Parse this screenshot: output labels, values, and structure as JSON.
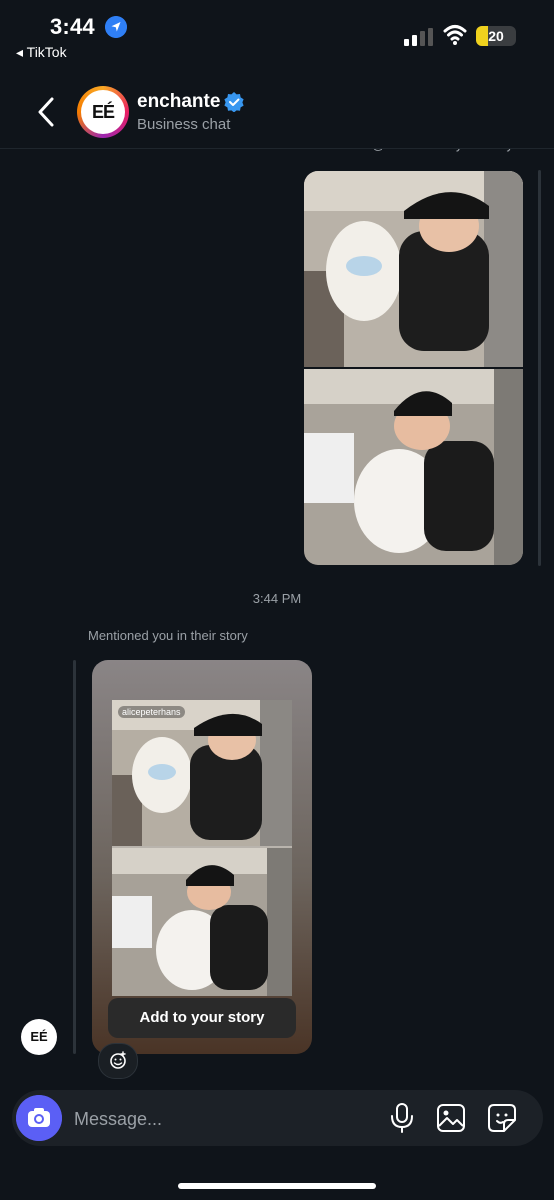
{
  "status_bar": {
    "time": "3:44",
    "back_app": "◂ TikTok",
    "battery": "20"
  },
  "header": {
    "back_label": "",
    "avatar_text": "EÉ",
    "name": "enchante",
    "subtitle": "Business chat"
  },
  "thread": {
    "clipped_note": "You mentioned @enchante in your story",
    "timestamp": "3:44 PM",
    "mention_label": "Mentioned you in their story",
    "story_tag": "alicepeterhans",
    "add_button": "Add to your story",
    "sender_avatar_text": "EÉ"
  },
  "composer": {
    "placeholder": "Message..."
  },
  "colors": {
    "background": "#0f141a",
    "accent": "#5b5ff5",
    "verified": "#3897f0"
  }
}
